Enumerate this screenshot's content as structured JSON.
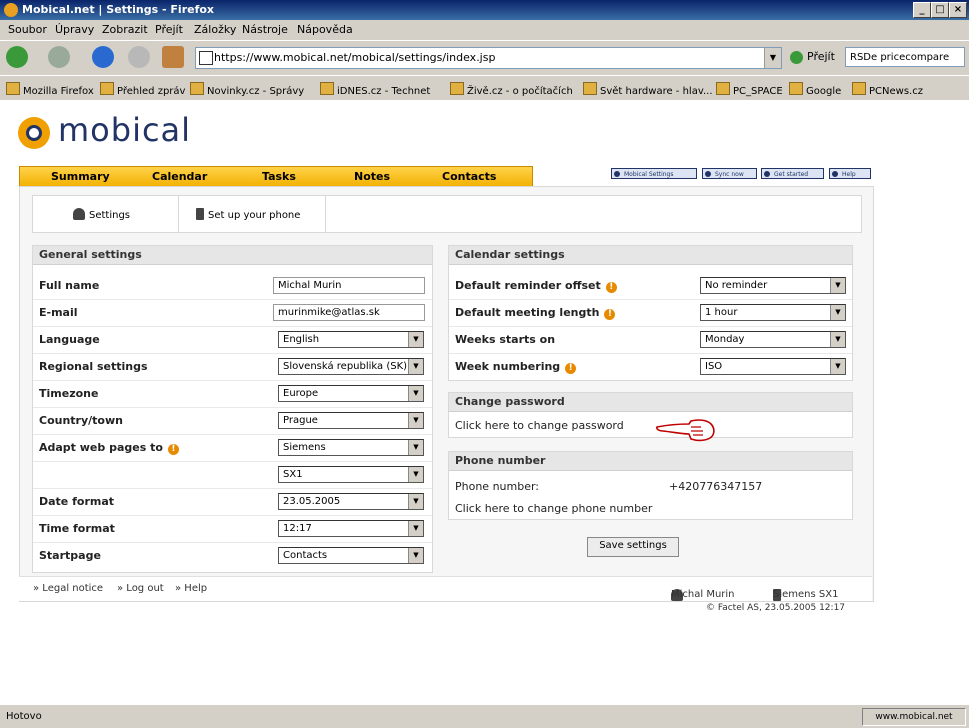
{
  "window": {
    "title": "Mobical.net | Settings - Firefox",
    "min": "_",
    "max": "□",
    "close": "×"
  },
  "menu": [
    "Soubor",
    "Úpravy",
    "Zobrazit",
    "Přejít",
    "Záložky",
    "Nástroje",
    "Nápověda"
  ],
  "nav": {
    "url": "https://www.mobical.net/mobical/settings/index.jsp",
    "go_label": "Přejít",
    "search_placeholder": "RSDe pricecompare"
  },
  "bookmarks": [
    "Mozilla Firefox",
    "Přehled zpráv",
    "Novinky.cz - Správy",
    "iDNES.cz - Technet",
    "Živě.cz - o počítačích",
    "Svět hardware - hlav...",
    "PC_SPACE",
    "Google",
    "PCNews.cz"
  ],
  "app": {
    "logo_text": "mobical",
    "tabs": [
      "Summary",
      "Calendar",
      "Tasks",
      "Notes",
      "Contacts"
    ],
    "top_links": [
      "Mobical Settings",
      "Sync now",
      "Get started",
      "Help"
    ],
    "subnav": [
      "Settings",
      "Set up your phone"
    ]
  },
  "general": {
    "header": "General settings",
    "full_name_label": "Full name",
    "full_name": "Michal Murin",
    "email_label": "E-mail",
    "email": "murinmike@atlas.sk",
    "language_label": "Language",
    "language": "English",
    "regional_label": "Regional settings",
    "regional": "Slovenská republika (SK)",
    "timezone_label": "Timezone",
    "timezone": "Europe",
    "country_label": "Country/town",
    "country": "Prague",
    "adapt_label": "Adapt web pages to",
    "adapt_brand": "Siemens",
    "adapt_model": "SX1",
    "date_label": "Date format",
    "date": "23.05.2005",
    "time_label": "Time format",
    "time": "12:17",
    "startpage_label": "Startpage",
    "startpage": "Contacts"
  },
  "calendar": {
    "header": "Calendar settings",
    "reminder_label": "Default reminder offset",
    "reminder": "No reminder",
    "meeting_label": "Default meeting length",
    "meeting": "1 hour",
    "week_start_label": "Weeks starts on",
    "week_start": "Monday",
    "numbering_label": "Week numbering",
    "numbering": "ISO"
  },
  "password": {
    "header": "Change password",
    "link": "Click here to change password"
  },
  "phone": {
    "header": "Phone number",
    "label": "Phone number:",
    "value": "+420776347157",
    "link": "Click here to change phone number"
  },
  "save_label": "Save settings",
  "footer": {
    "links": [
      "» Legal notice",
      "» Log out",
      "» Help"
    ],
    "user": "Michal Murin",
    "device": "Siemens SX1",
    "copyright": "© Factel AS, 23.05.2005 12:17"
  },
  "status": {
    "left": "Hotovo",
    "right": "www.mobical.net"
  }
}
